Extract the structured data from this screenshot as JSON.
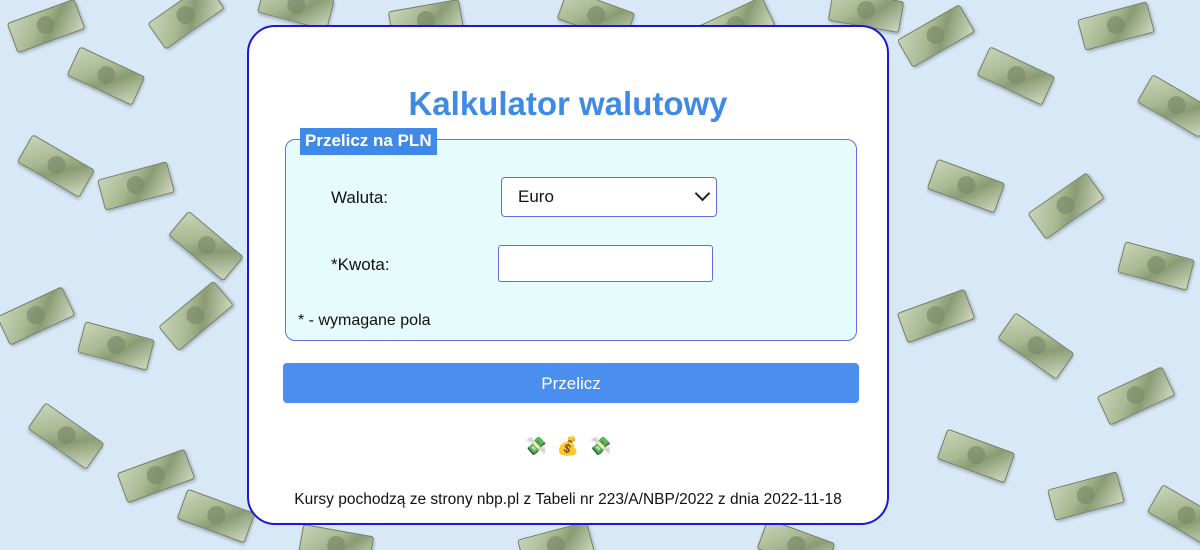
{
  "page": {
    "title": "Kalkulator walutowy",
    "legend": "Przelicz na PLN",
    "currency_label": "Waluta:",
    "currency_selected": "Euro",
    "amount_label": "*Kwota:",
    "amount_value": "",
    "required_note": "* - wymagane pola",
    "submit_label": "Przelicz",
    "emoji": [
      "💸",
      "💰",
      "💸"
    ],
    "footer": "Kursy pochodzą ze strony nbp.pl z Tabeli nr 223/A/NBP/2022 z dnia 2022-11-18"
  },
  "colors": {
    "accent": "#3f8ae6",
    "button": "#4a8ff0",
    "card_border": "#1a1ad6",
    "fieldset_bg": "#e6fbfb",
    "page_bg": "#d9e8f7"
  }
}
